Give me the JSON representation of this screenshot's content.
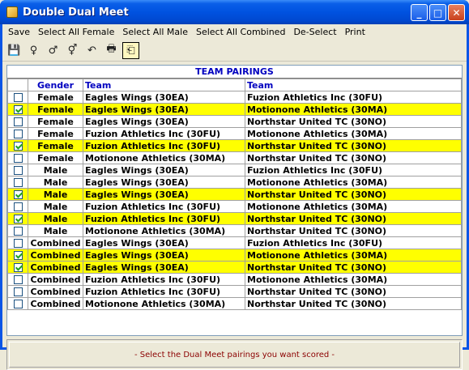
{
  "window": {
    "title": "Double Dual Meet",
    "minimize": "_",
    "maximize": "□",
    "close": "✕"
  },
  "menu": [
    "Save",
    "Select All Female",
    "Select All Male",
    "Select All Combined",
    "De-Select",
    "Print"
  ],
  "toolbar": [
    {
      "name": "save-tool-icon",
      "glyph": "💾"
    },
    {
      "name": "select-female-tool-icon",
      "glyph": "♀"
    },
    {
      "name": "select-male-tool-icon",
      "glyph": "♂"
    },
    {
      "name": "select-combined-tool-icon",
      "glyph": "⚥"
    },
    {
      "name": "deselect-tool-icon",
      "glyph": "↶"
    },
    {
      "name": "print-tool-icon",
      "glyph": "🖶"
    },
    {
      "name": "exit-tool-icon",
      "glyph": "⎗"
    }
  ],
  "grid": {
    "title": "TEAM PAIRINGS",
    "headers": {
      "check": "",
      "gender": "Gender",
      "team1": "Team",
      "team2": "Team"
    },
    "rows": [
      {
        "checked": false,
        "gender": "Female",
        "team1": "Eagles Wings (30EA)",
        "team2": "Fuzion Athletics Inc (30FU)"
      },
      {
        "checked": true,
        "gender": "Female",
        "team1": "Eagles Wings (30EA)",
        "team2": "Motionone Athletics (30MA)"
      },
      {
        "checked": false,
        "gender": "Female",
        "team1": "Eagles Wings (30EA)",
        "team2": "Northstar United TC (30NO)"
      },
      {
        "checked": false,
        "gender": "Female",
        "team1": "Fuzion Athletics Inc (30FU)",
        "team2": "Motionone Athletics (30MA)"
      },
      {
        "checked": true,
        "gender": "Female",
        "team1": "Fuzion Athletics Inc (30FU)",
        "team2": "Northstar United TC (30NO)"
      },
      {
        "checked": false,
        "gender": "Female",
        "team1": "Motionone Athletics (30MA)",
        "team2": "Northstar United TC (30NO)"
      },
      {
        "checked": false,
        "gender": "Male",
        "team1": "Eagles Wings (30EA)",
        "team2": "Fuzion Athletics Inc (30FU)"
      },
      {
        "checked": false,
        "gender": "Male",
        "team1": "Eagles Wings (30EA)",
        "team2": "Motionone Athletics (30MA)"
      },
      {
        "checked": true,
        "gender": "Male",
        "team1": "Eagles Wings (30EA)",
        "team2": "Northstar United TC (30NO)"
      },
      {
        "checked": false,
        "gender": "Male",
        "team1": "Fuzion Athletics Inc (30FU)",
        "team2": "Motionone Athletics (30MA)"
      },
      {
        "checked": true,
        "gender": "Male",
        "team1": "Fuzion Athletics Inc (30FU)",
        "team2": "Northstar United TC (30NO)"
      },
      {
        "checked": false,
        "gender": "Male",
        "team1": "Motionone Athletics (30MA)",
        "team2": "Northstar United TC (30NO)"
      },
      {
        "checked": false,
        "gender": "Combined",
        "team1": "Eagles Wings (30EA)",
        "team2": "Fuzion Athletics Inc (30FU)"
      },
      {
        "checked": true,
        "gender": "Combined",
        "team1": "Eagles Wings (30EA)",
        "team2": "Motionone Athletics (30MA)"
      },
      {
        "checked": true,
        "gender": "Combined",
        "team1": "Eagles Wings (30EA)",
        "team2": "Northstar United TC (30NO)"
      },
      {
        "checked": false,
        "gender": "Combined",
        "team1": "Fuzion Athletics Inc (30FU)",
        "team2": "Motionone Athletics (30MA)"
      },
      {
        "checked": false,
        "gender": "Combined",
        "team1": "Fuzion Athletics Inc (30FU)",
        "team2": "Northstar United TC (30NO)"
      },
      {
        "checked": false,
        "gender": "Combined",
        "team1": "Motionone Athletics (30MA)",
        "team2": "Northstar United TC (30NO)"
      }
    ]
  },
  "status": "- Select the Dual Meet pairings you want scored -",
  "colors": {
    "selected_row": "#ffff00",
    "header_text": "#0000c0",
    "status_text": "#8b0000"
  }
}
